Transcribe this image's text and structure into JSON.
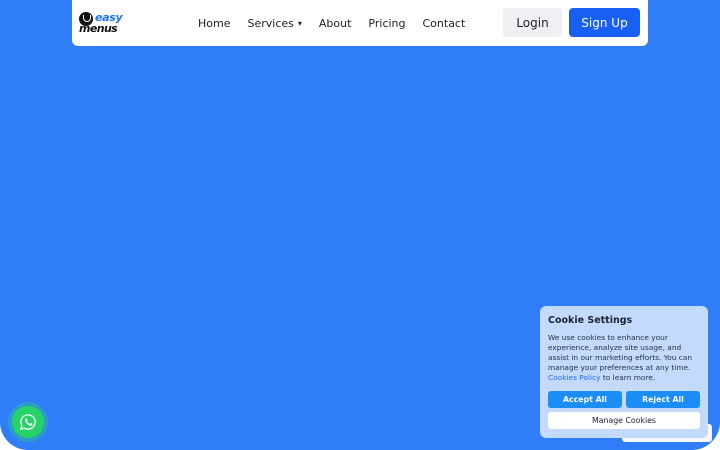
{
  "header": {
    "logo": {
      "line1": "easy",
      "line2": "menus"
    },
    "nav": [
      {
        "label": "Home"
      },
      {
        "label": "Services",
        "caret": "▾"
      },
      {
        "label": "About"
      },
      {
        "label": "Pricing"
      },
      {
        "label": "Contact"
      }
    ],
    "login_label": "Login",
    "signup_label": "Sign Up"
  },
  "cookie_banner": {
    "title": "Cookie Settings",
    "body": "We use cookies to enhance your experience, analyze site usage, and assist in our marketing efforts. You can manage your preferences at any time.",
    "policy_link": "Cookies Policy",
    "policy_suffix": " to learn more.",
    "accept_label": "Accept All",
    "reject_label": "Reject All",
    "manage_label": "Manage Cookies"
  },
  "floating": {
    "whatsapp_icon": "whatsapp-icon"
  },
  "colors": {
    "background": "#2f7ef8",
    "primary_button": "#1860f3",
    "cookie_panel": "#c4dafd",
    "cookie_button": "#1a8ef5",
    "whatsapp": "#25d366"
  }
}
